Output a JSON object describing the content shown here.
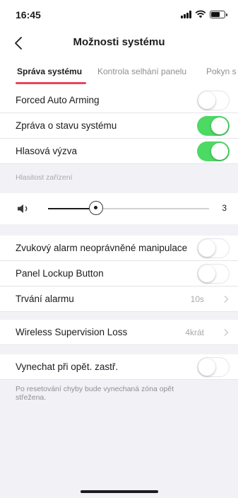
{
  "status_bar": {
    "time": "16:45"
  },
  "nav": {
    "title": "Možnosti systému"
  },
  "tabs": [
    {
      "label": "Správa systému",
      "active": true
    },
    {
      "label": "Kontrola selhání panelu",
      "active": false
    },
    {
      "label": "Pokyn s",
      "active": false
    }
  ],
  "settings_group_1": [
    {
      "label": "Forced Auto Arming",
      "toggle": false
    },
    {
      "label": "Zpráva o stavu systému",
      "toggle": true
    },
    {
      "label": "Hlasová výzva",
      "toggle": true
    }
  ],
  "volume": {
    "section_label": "Hlasitost zařízení",
    "value": "3",
    "level_fraction": 0.3
  },
  "settings_group_2": [
    {
      "label": "Zvukový alarm neoprávněné manipulace",
      "toggle": false
    },
    {
      "label": "Panel Lockup Button",
      "toggle": false
    },
    {
      "label": "Trvání alarmu",
      "value": "10s"
    }
  ],
  "wireless": {
    "label": "Wireless Supervision Loss",
    "value": "4krát"
  },
  "bypass": {
    "label": "Vynechat při opět. zastř.",
    "toggle": false,
    "note": "Po resetování chyby bude vynechaná zóna opět střežena."
  },
  "colors": {
    "accent": "#e8455b",
    "toggle_on": "#4cd964"
  }
}
